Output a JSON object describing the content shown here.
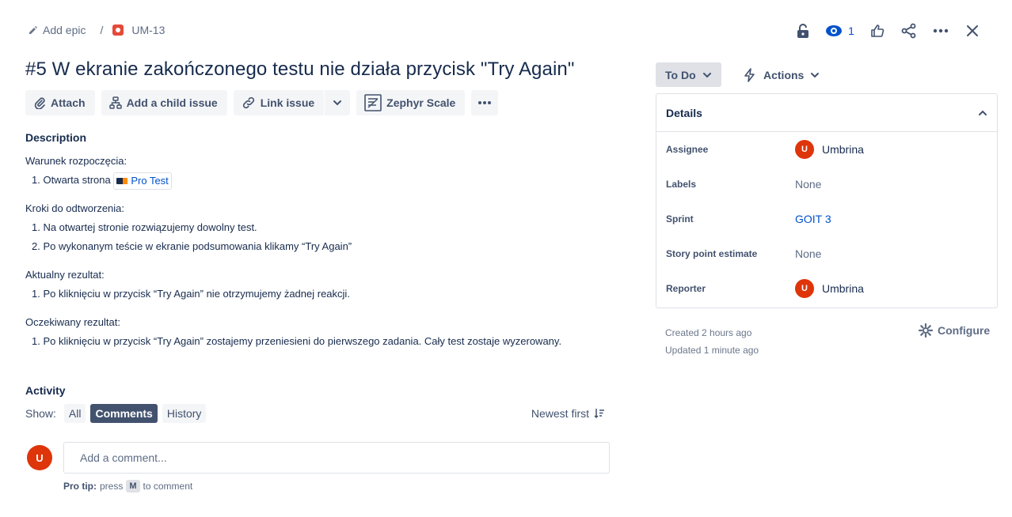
{
  "breadcrumb": {
    "epic_label": "Add epic",
    "separator": "/",
    "issue_key": "UM-13"
  },
  "header_actions": {
    "watch_count": "1"
  },
  "issue": {
    "title": "#5 W ekranie zakończonego testu nie działa przycisk \"Try Again\""
  },
  "toolbar": {
    "attach": "Attach",
    "add_child": "Add a child issue",
    "link_issue": "Link issue",
    "zephyr": "Zephyr Scale"
  },
  "description": {
    "heading": "Description",
    "precondition_label": "Warunek rozpoczęcia:",
    "precondition_item_prefix": "1. Otwarta strona",
    "precondition_link": "Pro Test",
    "steps_label": "Kroki do odtworzenia:",
    "steps": [
      "1. Na otwartej stronie rozwiązujemy dowolny test.",
      "2. Po wykonanym teście w ekranie podsumowania klikamy “Try Again”"
    ],
    "actual_label": "Aktualny rezultat:",
    "actual": "1. Po kliknięciu w przycisk “Try Again” nie otrzymujemy żadnej reakcji.",
    "expected_label": "Oczekiwany rezultat:",
    "expected": "1. Po kliknięciu w przycisk “Try Again” zostajemy przeniesieni do pierwszego zadania. Cały test zostaje wyzerowany."
  },
  "activity": {
    "heading": "Activity",
    "show_label": "Show:",
    "filters": [
      "All",
      "Comments",
      "History"
    ],
    "active_filter": "Comments",
    "sort": "Newest first",
    "comment_placeholder": "Add a comment...",
    "avatar_initial": "U",
    "protip_bold": "Pro tip:",
    "protip_press": "press",
    "protip_key": "M",
    "protip_suffix": "to comment"
  },
  "status": {
    "label": "To Do",
    "actions_label": "Actions"
  },
  "details": {
    "heading": "Details",
    "rows": [
      {
        "key": "Assignee",
        "value": "Umbrina",
        "avatar": "U"
      },
      {
        "key": "Labels",
        "value": "None"
      },
      {
        "key": "Sprint",
        "value": "GOIT 3"
      },
      {
        "key": "Story point estimate",
        "value": "None"
      },
      {
        "key": "Reporter",
        "value": "Umbrina",
        "avatar": "U"
      }
    ]
  },
  "meta": {
    "created": "Created 2 hours ago",
    "updated": "Updated 1 minute ago",
    "configure": "Configure"
  },
  "colors": {
    "accent": "#0052cc",
    "avatar": "#de350b",
    "bug": "#e5493a",
    "active_chip": "#42526e"
  }
}
